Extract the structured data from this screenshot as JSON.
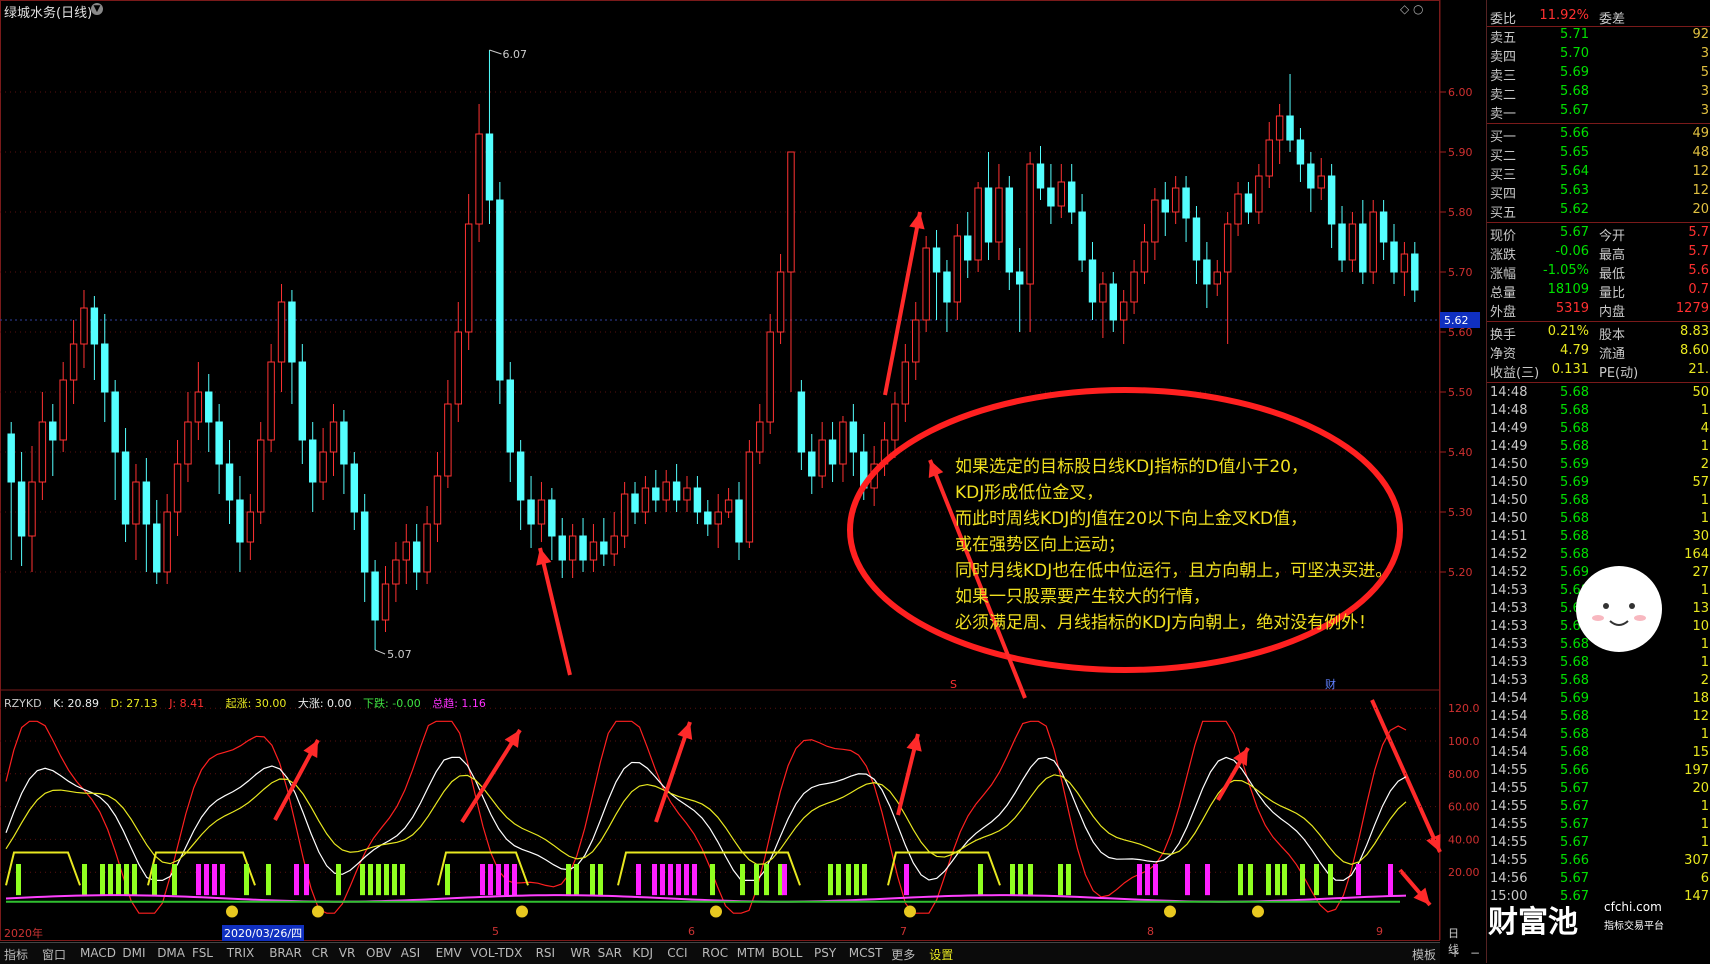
{
  "stock": {
    "title": "绿城水务(日线)",
    "period_label": "日线"
  },
  "chart_data": {
    "type": "candlestick",
    "price_axis": [
      "6.00",
      "5.90",
      "5.80",
      "5.70",
      "5.60",
      "5.50",
      "5.40",
      "5.30",
      "5.20"
    ],
    "current_price_tag": "5.62",
    "high_marker": "6.07",
    "low_marker": "5.07",
    "candles": [
      [
        5.43,
        5.35,
        5.45,
        5.22
      ],
      [
        5.35,
        5.26,
        5.4,
        5.21
      ],
      [
        5.26,
        5.35,
        5.41,
        5.2
      ],
      [
        5.35,
        5.45,
        5.5,
        5.32
      ],
      [
        5.45,
        5.42,
        5.48,
        5.36
      ],
      [
        5.42,
        5.52,
        5.55,
        5.4
      ],
      [
        5.52,
        5.58,
        5.62,
        5.48
      ],
      [
        5.58,
        5.64,
        5.67,
        5.54
      ],
      [
        5.64,
        5.58,
        5.66,
        5.52
      ],
      [
        5.58,
        5.5,
        5.63,
        5.45
      ],
      [
        5.5,
        5.4,
        5.52,
        5.32
      ],
      [
        5.4,
        5.28,
        5.44,
        5.25
      ],
      [
        5.28,
        5.35,
        5.38,
        5.22
      ],
      [
        5.35,
        5.28,
        5.39,
        5.2
      ],
      [
        5.28,
        5.2,
        5.32,
        5.18
      ],
      [
        5.2,
        5.3,
        5.33,
        5.18
      ],
      [
        5.3,
        5.38,
        5.42,
        5.26
      ],
      [
        5.38,
        5.45,
        5.5,
        5.35
      ],
      [
        5.45,
        5.5,
        5.55,
        5.42
      ],
      [
        5.5,
        5.45,
        5.53,
        5.4
      ],
      [
        5.45,
        5.38,
        5.48,
        5.33
      ],
      [
        5.38,
        5.32,
        5.42,
        5.28
      ],
      [
        5.32,
        5.25,
        5.36,
        5.2
      ],
      [
        5.25,
        5.3,
        5.33,
        5.22
      ],
      [
        5.3,
        5.42,
        5.45,
        5.28
      ],
      [
        5.42,
        5.55,
        5.58,
        5.4
      ],
      [
        5.55,
        5.65,
        5.68,
        5.5
      ],
      [
        5.65,
        5.55,
        5.67,
        5.48
      ],
      [
        5.55,
        5.42,
        5.58,
        5.38
      ],
      [
        5.42,
        5.35,
        5.45,
        5.3
      ],
      [
        5.35,
        5.4,
        5.44,
        5.32
      ],
      [
        5.4,
        5.45,
        5.48,
        5.36
      ],
      [
        5.45,
        5.38,
        5.47,
        5.33
      ],
      [
        5.38,
        5.3,
        5.4,
        5.27
      ],
      [
        5.3,
        5.2,
        5.33,
        5.15
      ],
      [
        5.2,
        5.12,
        5.22,
        5.07
      ],
      [
        5.12,
        5.18,
        5.21,
        5.1
      ],
      [
        5.18,
        5.22,
        5.25,
        5.15
      ],
      [
        5.22,
        5.25,
        5.28,
        5.18
      ],
      [
        5.25,
        5.2,
        5.28,
        5.17
      ],
      [
        5.2,
        5.28,
        5.31,
        5.18
      ],
      [
        5.28,
        5.36,
        5.4,
        5.25
      ],
      [
        5.36,
        5.48,
        5.52,
        5.34
      ],
      [
        5.48,
        5.6,
        5.65,
        5.45
      ],
      [
        5.6,
        5.78,
        5.83,
        5.57
      ],
      [
        5.78,
        5.93,
        5.98,
        5.75
      ],
      [
        5.93,
        5.82,
        6.07,
        5.78
      ],
      [
        5.82,
        5.52,
        5.85,
        5.48
      ],
      [
        5.52,
        5.4,
        5.55,
        5.35
      ],
      [
        5.4,
        5.32,
        5.42,
        5.27
      ],
      [
        5.32,
        5.28,
        5.36,
        5.24
      ],
      [
        5.28,
        5.32,
        5.35,
        5.25
      ],
      [
        5.32,
        5.26,
        5.34,
        5.22
      ],
      [
        5.26,
        5.22,
        5.29,
        5.19
      ],
      [
        5.22,
        5.26,
        5.28,
        5.19
      ],
      [
        5.26,
        5.22,
        5.29,
        5.2
      ],
      [
        5.22,
        5.25,
        5.28,
        5.2
      ],
      [
        5.25,
        5.23,
        5.29,
        5.21
      ],
      [
        5.23,
        5.26,
        5.3,
        5.21
      ],
      [
        5.26,
        5.33,
        5.35,
        5.24
      ],
      [
        5.33,
        5.3,
        5.35,
        5.28
      ],
      [
        5.3,
        5.34,
        5.36,
        5.28
      ],
      [
        5.34,
        5.32,
        5.37,
        5.3
      ],
      [
        5.32,
        5.35,
        5.37,
        5.3
      ],
      [
        5.35,
        5.32,
        5.38,
        5.3
      ],
      [
        5.32,
        5.34,
        5.36,
        5.3
      ],
      [
        5.34,
        5.3,
        5.36,
        5.28
      ],
      [
        5.3,
        5.28,
        5.32,
        5.26
      ],
      [
        5.28,
        5.3,
        5.33,
        5.24
      ],
      [
        5.3,
        5.32,
        5.34,
        5.29
      ],
      [
        5.32,
        5.25,
        5.35,
        5.22
      ],
      [
        5.25,
        5.4,
        5.42,
        5.24
      ],
      [
        5.4,
        5.45,
        5.48,
        5.38
      ],
      [
        5.45,
        5.6,
        5.63,
        5.43
      ],
      [
        5.6,
        5.7,
        5.73,
        5.58
      ],
      [
        5.7,
        5.9,
        5.9,
        5.5
      ],
      [
        5.5,
        5.4,
        5.52,
        5.37
      ],
      [
        5.4,
        5.36,
        5.43,
        5.33
      ],
      [
        5.36,
        5.42,
        5.45,
        5.34
      ],
      [
        5.42,
        5.38,
        5.45,
        5.35
      ],
      [
        5.38,
        5.45,
        5.46,
        5.35
      ],
      [
        5.45,
        5.4,
        5.48,
        5.36
      ],
      [
        5.4,
        5.34,
        5.43,
        5.32
      ],
      [
        5.34,
        5.38,
        5.41,
        5.31
      ],
      [
        5.38,
        5.42,
        5.45,
        5.36
      ],
      [
        5.42,
        5.48,
        5.5,
        5.39
      ],
      [
        5.48,
        5.55,
        5.58,
        5.45
      ],
      [
        5.55,
        5.62,
        5.65,
        5.52
      ],
      [
        5.62,
        5.74,
        5.76,
        5.6
      ],
      [
        5.74,
        5.7,
        5.77,
        5.62
      ],
      [
        5.7,
        5.65,
        5.72,
        5.6
      ],
      [
        5.65,
        5.76,
        5.78,
        5.62
      ],
      [
        5.76,
        5.72,
        5.8,
        5.69
      ],
      [
        5.72,
        5.84,
        5.85,
        5.7
      ],
      [
        5.84,
        5.75,
        5.9,
        5.72
      ],
      [
        5.75,
        5.84,
        5.88,
        5.72
      ],
      [
        5.84,
        5.7,
        5.86,
        5.67
      ],
      [
        5.7,
        5.68,
        5.74,
        5.6
      ],
      [
        5.68,
        5.88,
        5.9,
        5.6
      ],
      [
        5.88,
        5.84,
        5.91,
        5.82
      ],
      [
        5.84,
        5.81,
        5.88,
        5.78
      ],
      [
        5.81,
        5.85,
        5.88,
        5.79
      ],
      [
        5.85,
        5.8,
        5.88,
        5.78
      ],
      [
        5.8,
        5.72,
        5.83,
        5.7
      ],
      [
        5.72,
        5.65,
        5.75,
        5.62
      ],
      [
        5.65,
        5.68,
        5.7,
        5.59
      ],
      [
        5.68,
        5.62,
        5.7,
        5.6
      ],
      [
        5.62,
        5.65,
        5.67,
        5.58
      ],
      [
        5.65,
        5.7,
        5.72,
        5.63
      ],
      [
        5.7,
        5.75,
        5.78,
        5.68
      ],
      [
        5.75,
        5.82,
        5.84,
        5.72
      ],
      [
        5.82,
        5.8,
        5.85,
        5.76
      ],
      [
        5.8,
        5.84,
        5.86,
        5.78
      ],
      [
        5.84,
        5.79,
        5.86,
        5.75
      ],
      [
        5.79,
        5.72,
        5.81,
        5.68
      ],
      [
        5.72,
        5.68,
        5.75,
        5.64
      ],
      [
        5.68,
        5.7,
        5.72,
        5.66
      ],
      [
        5.7,
        5.78,
        5.8,
        5.58
      ],
      [
        5.78,
        5.83,
        5.85,
        5.76
      ],
      [
        5.83,
        5.8,
        5.85,
        5.78
      ],
      [
        5.8,
        5.86,
        5.88,
        5.78
      ],
      [
        5.86,
        5.92,
        5.95,
        5.84
      ],
      [
        5.92,
        5.96,
        5.98,
        5.88
      ],
      [
        5.96,
        5.92,
        6.03,
        5.9
      ],
      [
        5.92,
        5.88,
        5.94,
        5.85
      ],
      [
        5.88,
        5.84,
        5.9,
        5.8
      ],
      [
        5.84,
        5.86,
        5.89,
        5.82
      ],
      [
        5.86,
        5.78,
        5.88,
        5.74
      ],
      [
        5.78,
        5.72,
        5.81,
        5.7
      ],
      [
        5.72,
        5.78,
        5.8,
        5.7
      ],
      [
        5.78,
        5.7,
        5.82,
        5.68
      ],
      [
        5.7,
        5.8,
        5.82,
        5.68
      ],
      [
        5.8,
        5.75,
        5.82,
        5.72
      ],
      [
        5.75,
        5.7,
        5.78,
        5.68
      ],
      [
        5.7,
        5.73,
        5.75,
        5.66
      ],
      [
        5.73,
        5.67,
        5.75,
        5.65
      ]
    ],
    "kdj_axis": [
      "120.0",
      "100.0",
      "80.00",
      "60.00",
      "40.00",
      "20.00"
    ],
    "x_labels": [
      "2020年",
      "2020/03/26/四",
      "5",
      "6",
      "7",
      "8",
      "9"
    ]
  },
  "indicator": {
    "name": "RZYKD",
    "k": "K: 20.89",
    "d": "D: 27.13",
    "j": "J: 8.41",
    "qizhang": "起涨: 30.00",
    "dazhang": "大涨: 0.00",
    "xiadie": "下跌: -0.00",
    "zongqu": "总趋: 1.16"
  },
  "tabs": [
    "指标",
    "窗口",
    "MACD",
    "DMI",
    "DMA",
    "FSL",
    "TRIX",
    "BRAR",
    "CR",
    "VR",
    "OBV",
    "ASI",
    "EMV",
    "VOL-TDX",
    "RSI",
    "WR",
    "SAR",
    "KDJ",
    "CCI",
    "ROC",
    "MTM",
    "BOLL",
    "PSY",
    "MCST",
    "更多",
    "设置"
  ],
  "tab_right": [
    "模板",
    "+",
    "−"
  ],
  "annotation": [
    "如果选定的目标股日线KDJ指标的D值小于20，",
    "KDJ形成低位金叉，",
    "而此时周线KDJ的J值在20以下向上金叉KD值，",
    "或在强势区向上运动；",
    "同时月线KDJ也在低中位运行，且方向朝上，可坚决买进。",
    "如果一只股票要产生较大的行情，",
    "必须满足周、月线指标的KDJ方向朝上，绝对没有例外！"
  ],
  "quote": {
    "weibi_label": "委比",
    "weibi_val": "11.92%",
    "weicha_label": "委差",
    "sell": [
      {
        "label": "卖五",
        "price": "5.71",
        "vol": "92"
      },
      {
        "label": "卖四",
        "price": "5.70",
        "vol": "3"
      },
      {
        "label": "卖三",
        "price": "5.69",
        "vol": "5"
      },
      {
        "label": "卖二",
        "price": "5.68",
        "vol": "3"
      },
      {
        "label": "卖一",
        "price": "5.67",
        "vol": "3"
      }
    ],
    "buy": [
      {
        "label": "买一",
        "price": "5.66",
        "vol": "49"
      },
      {
        "label": "买二",
        "price": "5.65",
        "vol": "48"
      },
      {
        "label": "买三",
        "price": "5.64",
        "vol": "12"
      },
      {
        "label": "买四",
        "price": "5.63",
        "vol": "12"
      },
      {
        "label": "买五",
        "price": "5.62",
        "vol": "20"
      }
    ],
    "stats": [
      {
        "a": "现价",
        "b": "5.67",
        "c": "今开",
        "d": "5.7"
      },
      {
        "a": "涨跌",
        "b": "-0.06",
        "c": "最高",
        "d": "5.7"
      },
      {
        "a": "涨幅",
        "b": "-1.05%",
        "c": "最低",
        "d": "5.6"
      },
      {
        "a": "总量",
        "b": "18109",
        "c": "量比",
        "d": "0.7"
      },
      {
        "a": "外盘",
        "b": "5319",
        "c": "内盘",
        "d": "1279"
      }
    ],
    "stats2": [
      {
        "a": "换手",
        "b": "0.21%",
        "c": "股本",
        "d": "8.83"
      },
      {
        "a": "净资",
        "b": "4.79",
        "c": "流通",
        "d": "8.60"
      },
      {
        "a": "收益(三)",
        "b": "0.131",
        "c": "PE(动)",
        "d": "21."
      }
    ],
    "ticks": [
      {
        "t": "14:48",
        "p": "5.68",
        "v": "50"
      },
      {
        "t": "14:48",
        "p": "5.68",
        "v": "1"
      },
      {
        "t": "14:49",
        "p": "5.68",
        "v": "4"
      },
      {
        "t": "14:49",
        "p": "5.68",
        "v": "1"
      },
      {
        "t": "14:50",
        "p": "5.69",
        "v": "2"
      },
      {
        "t": "14:50",
        "p": "5.69",
        "v": "57"
      },
      {
        "t": "14:50",
        "p": "5.68",
        "v": "1"
      },
      {
        "t": "14:50",
        "p": "5.68",
        "v": "1"
      },
      {
        "t": "14:51",
        "p": "5.68",
        "v": "30"
      },
      {
        "t": "14:52",
        "p": "5.68",
        "v": "164"
      },
      {
        "t": "14:52",
        "p": "5.69",
        "v": "27"
      },
      {
        "t": "14:53",
        "p": "5.68",
        "v": "1"
      },
      {
        "t": "14:53",
        "p": "5.69",
        "v": "13"
      },
      {
        "t": "14:53",
        "p": "5.68",
        "v": "10"
      },
      {
        "t": "14:53",
        "p": "5.68",
        "v": "1"
      },
      {
        "t": "14:53",
        "p": "5.68",
        "v": "1"
      },
      {
        "t": "14:53",
        "p": "5.68",
        "v": "2"
      },
      {
        "t": "14:54",
        "p": "5.69",
        "v": "18"
      },
      {
        "t": "14:54",
        "p": "5.68",
        "v": "12"
      },
      {
        "t": "14:54",
        "p": "5.68",
        "v": "1"
      },
      {
        "t": "14:54",
        "p": "5.68",
        "v": "15"
      },
      {
        "t": "14:55",
        "p": "5.66",
        "v": "197"
      },
      {
        "t": "14:55",
        "p": "5.67",
        "v": "20"
      },
      {
        "t": "14:55",
        "p": "5.67",
        "v": "1"
      },
      {
        "t": "14:55",
        "p": "5.67",
        "v": "1"
      },
      {
        "t": "14:55",
        "p": "5.67",
        "v": "1"
      },
      {
        "t": "14:55",
        "p": "5.66",
        "v": "307"
      },
      {
        "t": "14:56",
        "p": "5.67",
        "v": "6"
      },
      {
        "t": "15:00",
        "p": "5.67",
        "v": "147"
      }
    ]
  },
  "watermark": {
    "brand": "财富池",
    "site": "cfchi.com",
    "slogan": "指标交易平台"
  }
}
